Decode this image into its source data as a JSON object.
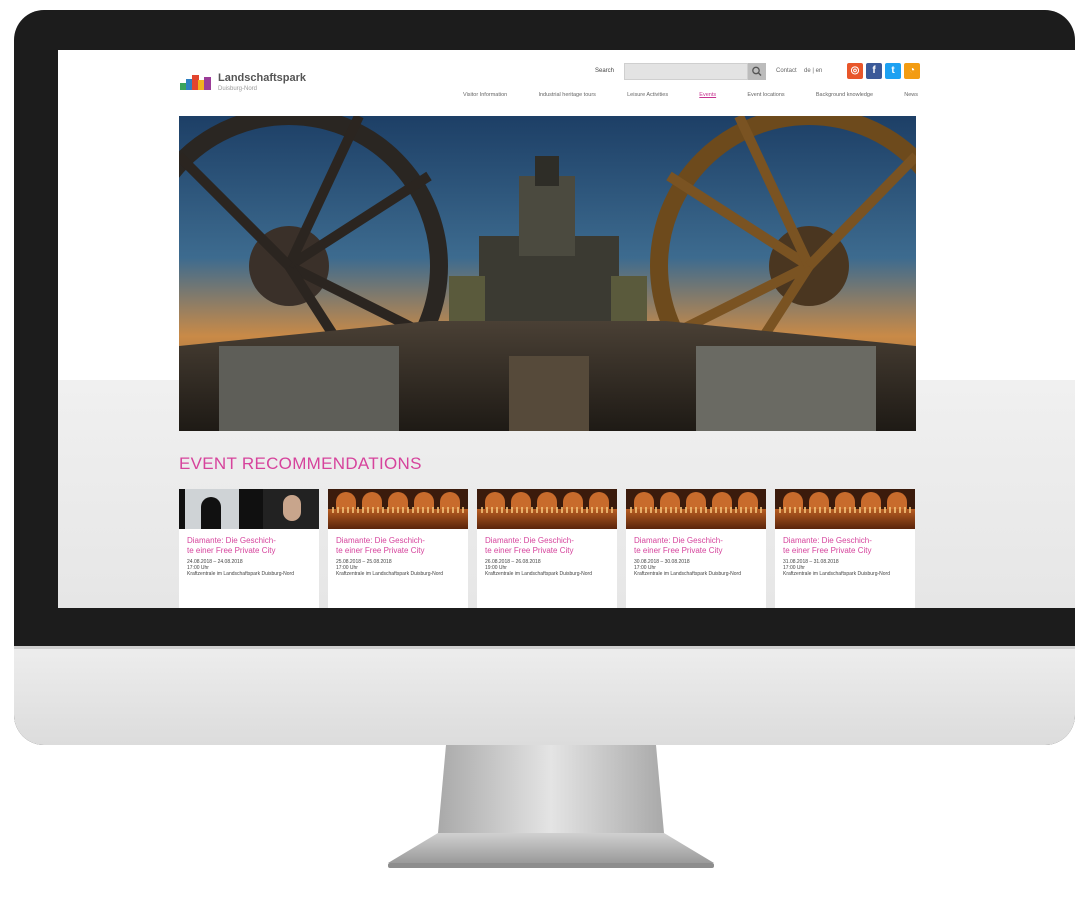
{
  "site": {
    "logo_name": "Landschaftspark",
    "logo_tagline": "Duisburg-Nord",
    "search_label": "Search",
    "search_placeholder": "",
    "contact": "Contact",
    "language": "de | en"
  },
  "nav": [
    {
      "label": "Visitor Information",
      "active": false
    },
    {
      "label": "Industrial heritage tours",
      "active": false
    },
    {
      "label": "Leisure Activities",
      "active": false
    },
    {
      "label": "Events",
      "active": true
    },
    {
      "label": "Event locations",
      "active": false
    },
    {
      "label": "Background knowledge",
      "active": false
    },
    {
      "label": "News",
      "active": false
    }
  ],
  "social": [
    {
      "icon": "instagram-icon",
      "glyph": "◎",
      "color": "#e8562a"
    },
    {
      "icon": "facebook-icon",
      "glyph": "f",
      "color": "#3b5998"
    },
    {
      "icon": "twitter-icon",
      "glyph": "t",
      "color": "#1da1f2"
    },
    {
      "icon": "rss-icon",
      "glyph": "◔",
      "color": "#f39c12"
    }
  ],
  "events": {
    "section_title": "EVENT RECOMMENDATIONS",
    "cards": [
      {
        "title": "Diamante: Die Geschich-\nte einer Free Private City",
        "date": "24.08.2018 – 24.08.2018",
        "time": "17:00 Uhr",
        "location": "Kraftzentrale im Landschaftspark Duisburg-Nord",
        "thumb": "portrait"
      },
      {
        "title": "Diamante: Die Geschich-\nte einer Free Private City",
        "date": "25.08.2018 – 25.08.2018",
        "time": "17:00 Uhr",
        "location": "Kraftzentrale im Landschaftspark Duisburg-Nord",
        "thumb": "hall"
      },
      {
        "title": "Diamante: Die Geschich-\nte einer Free Private City",
        "date": "26.08.2018 – 26.08.2018",
        "time": "19:00 Uhr",
        "location": "Kraftzentrale im Landschaftspark Duisburg-Nord",
        "thumb": "hall"
      },
      {
        "title": "Diamante: Die Geschich-\nte einer Free Private City",
        "date": "30.08.2018 – 30.08.2018",
        "time": "17:00 Uhr",
        "location": "Kraftzentrale im Landschaftspark Duisburg-Nord",
        "thumb": "hall"
      },
      {
        "title": "Diamante: Die Geschich-\nte einer Free Private City",
        "date": "31.08.2018 – 31.08.2018",
        "time": "17:00 Uhr",
        "location": "Kraftzentrale im Landschaftspark Duisburg-Nord",
        "thumb": "hall"
      }
    ]
  },
  "colors": {
    "accent": "#d6439c",
    "bezel": "#1c1c1c",
    "chin": "#e6e6e6"
  }
}
